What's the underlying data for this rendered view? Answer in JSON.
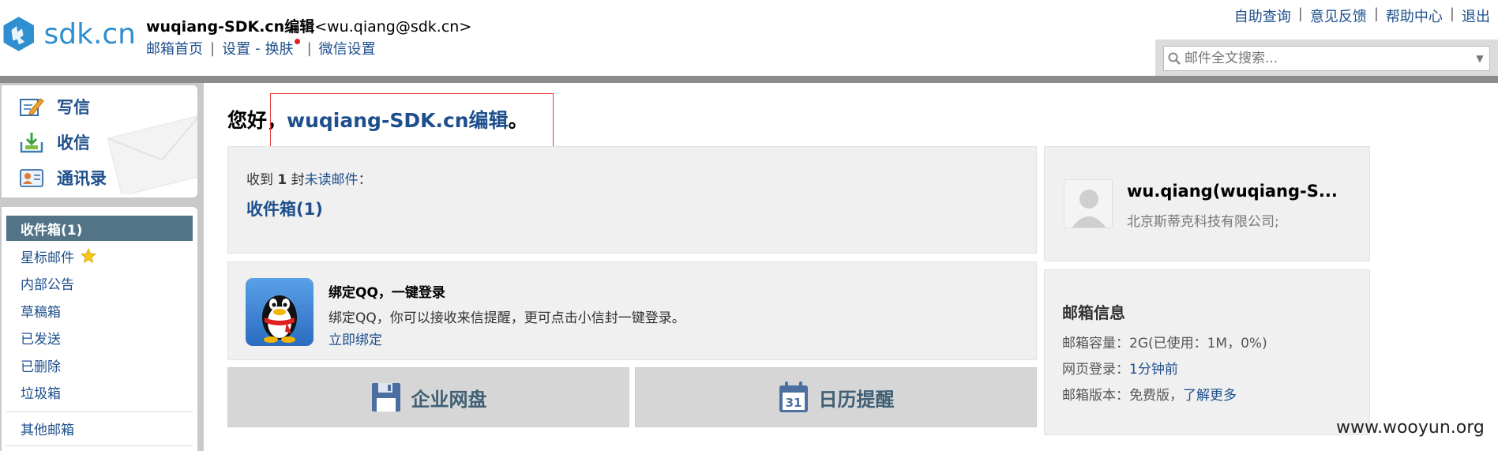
{
  "brand": {
    "logo_text": "sdk.cn"
  },
  "header": {
    "account_name": "wuqiang-SDK.cn编辑",
    "account_email": "<wu.qiang@sdk.cn>",
    "links": {
      "home": "邮箱首页",
      "settings": "设置",
      "dash": "-",
      "skin": "换肤",
      "wechat": "微信设置"
    },
    "sep": "|",
    "help_links": [
      "自助查询",
      "意见反馈",
      "帮助中心",
      "退出"
    ]
  },
  "search": {
    "placeholder": "邮件全文搜索..."
  },
  "sidebar": {
    "quick": {
      "compose": "写信",
      "receive": "收信",
      "contacts": "通讯录"
    },
    "folders": {
      "inbox": "收件箱(1)",
      "starred": "星标邮件",
      "announcements": "内部公告",
      "drafts": "草稿箱",
      "sent": "已发送",
      "deleted": "已删除",
      "spam": "垃圾箱",
      "other": "其他邮箱"
    }
  },
  "main": {
    "greeting_prefix": "您好，",
    "greeting_name": "wuqiang-SDK.cn编辑",
    "greeting_suffix": "。",
    "unread": {
      "prefix": "收到 ",
      "count": "1",
      "middle": " 封",
      "link": "未读邮件",
      "suffix": "："
    },
    "inbox_link": "收件箱(1)",
    "qq": {
      "title": "绑定QQ，一键登录",
      "desc": "绑定QQ，你可以接收来信提醒，更可点击小信封一键登录。",
      "bind_link": "立即绑定"
    },
    "netdisk_label": "企业网盘",
    "calendar_label": "日历提醒",
    "calendar_day": "31",
    "profile": {
      "name": "wu.qiang(wuqiang-S...",
      "company": "北京斯蒂克科技有限公司;"
    },
    "mailbox_info": {
      "title": "邮箱信息",
      "capacity": "邮箱容量：2G(已使用：1M，0%)",
      "login_label": "网页登录：",
      "login_value": "1分钟前",
      "version_label": "邮箱版本：免费版，",
      "version_link": "了解更多"
    }
  },
  "watermark": "www.wooyun.org",
  "colors": {
    "link": "#1e4f8c",
    "active_folder": "#537487",
    "highlight_box": "#e43b3b",
    "logo": "#2f8fd0"
  }
}
